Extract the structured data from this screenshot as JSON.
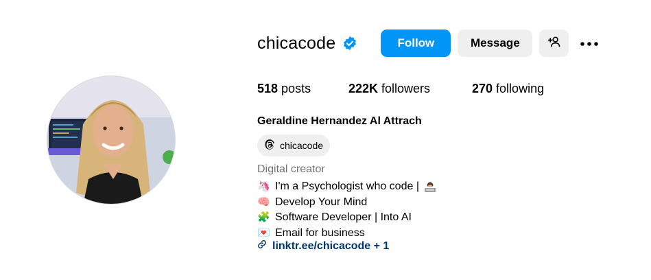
{
  "profile": {
    "username": "chicacode",
    "verified_icon": "verified-badge-icon",
    "full_name": "Geraldine Hernandez Al Attrach",
    "category": "Digital creator",
    "threads_handle": "chicacode"
  },
  "actions": {
    "follow_label": "Follow",
    "message_label": "Message",
    "add_user_icon": "add-user-icon",
    "more_icon": "more-options-icon"
  },
  "stats": {
    "posts_count": "518",
    "posts_label": "posts",
    "followers_count": "222K",
    "followers_label": "followers",
    "following_count": "270",
    "following_label": "following"
  },
  "bio": {
    "lines": [
      {
        "emoji": "🦄",
        "icon": "unicorn-icon",
        "text": "I'm a Psychologist who code |"
      },
      {
        "emoji": "🧠",
        "icon": "brain-icon",
        "text": "Develop Your Mind"
      },
      {
        "emoji": "🧩",
        "icon": "puzzle-icon",
        "text": "Software Developer | Into AI"
      },
      {
        "emoji": "💌",
        "icon": "love-letter-icon",
        "text": "Email for business"
      }
    ],
    "link_text": "linktr.ee/chicacode + 1"
  },
  "colors": {
    "primary_button": "#0095f6",
    "secondary_button": "#efefef",
    "link": "#00376b",
    "muted_text": "#737373",
    "verified": "#0095f6"
  }
}
